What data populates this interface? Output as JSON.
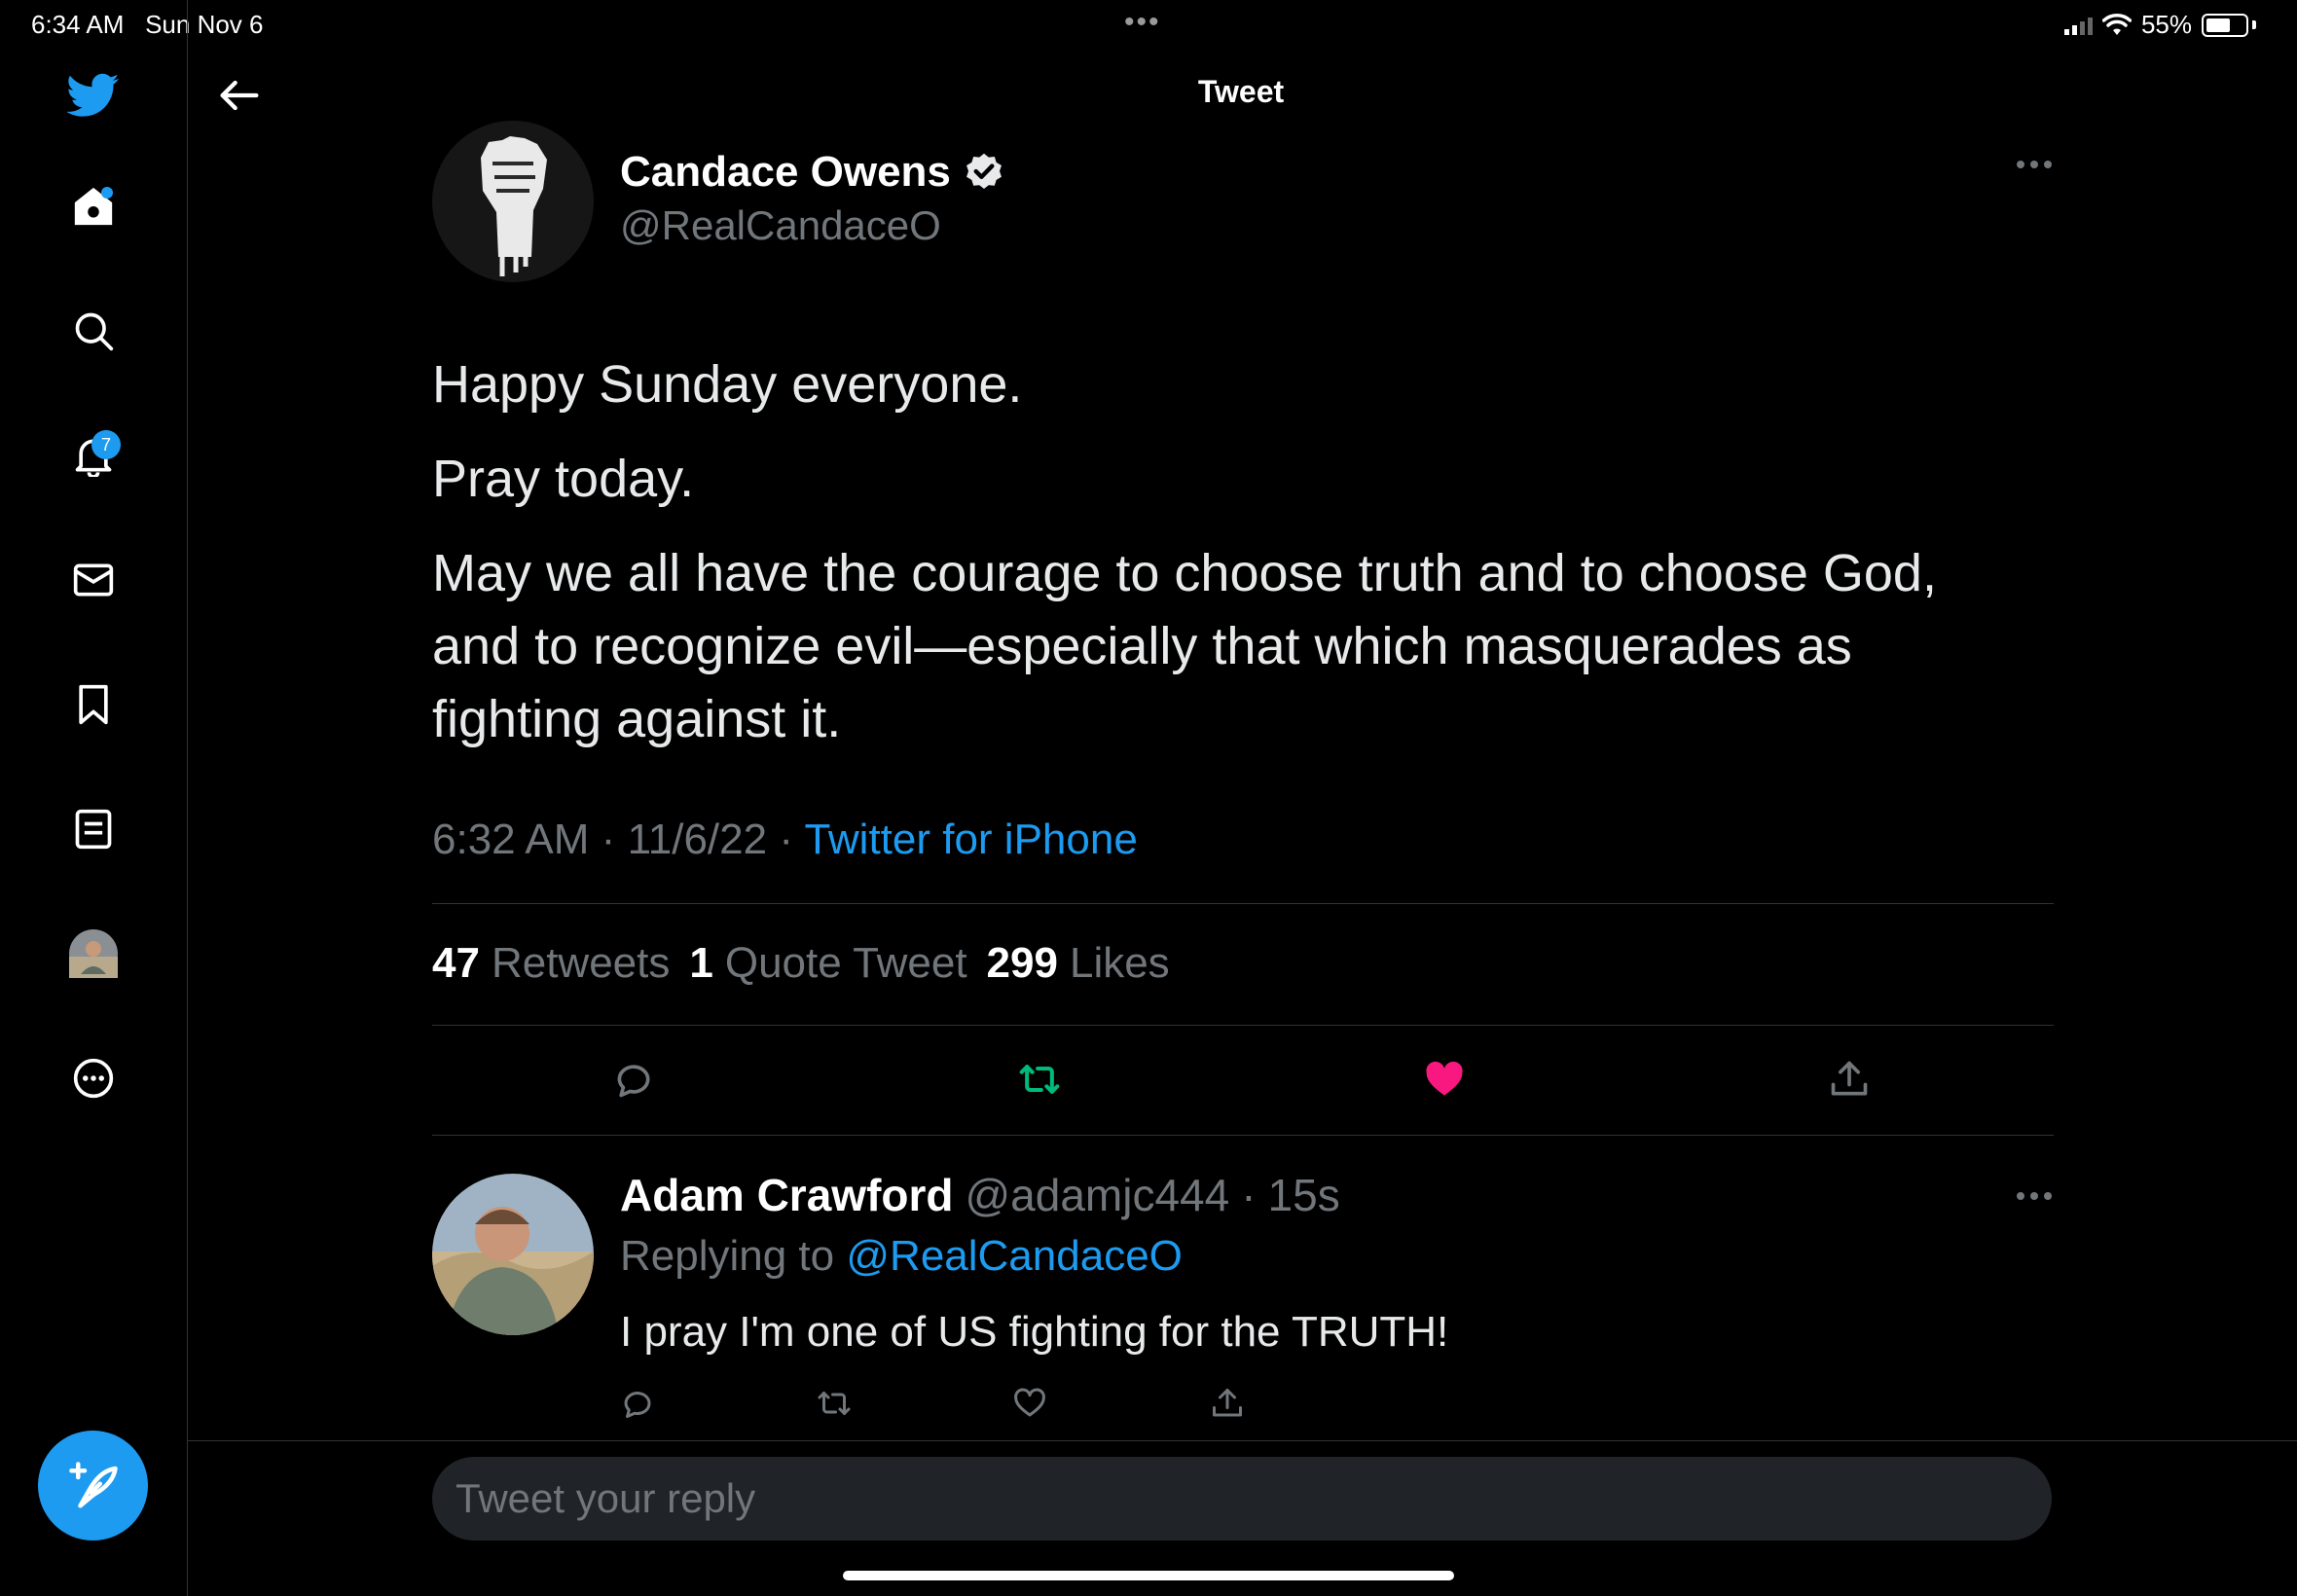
{
  "status_bar": {
    "time": "6:34 AM",
    "date": "Sun Nov 6",
    "battery": "55%",
    "dots": "•••"
  },
  "sidebar": {
    "items": [
      {
        "icon": "twitter-logo-icon"
      },
      {
        "icon": "home-icon",
        "has_dot": true
      },
      {
        "icon": "search-icon"
      },
      {
        "icon": "notifications-icon",
        "badge": "7"
      },
      {
        "icon": "messages-icon"
      },
      {
        "icon": "bookmarks-icon"
      },
      {
        "icon": "lists-icon"
      },
      {
        "icon": "profile-avatar"
      },
      {
        "icon": "more-icon"
      }
    ],
    "compose_icon": "compose-tweet-icon"
  },
  "header": {
    "title": "Tweet"
  },
  "tweet": {
    "author_name": "Candace Owens",
    "author_handle": "@RealCandaceO",
    "verified": true,
    "lines": [
      "Happy Sunday everyone.",
      "Pray today.",
      "May we all have the courage to choose truth and to choose God,",
      "and to recognize evil—especially that which masquerades as",
      "fighting against it."
    ],
    "time": "6:32 AM",
    "date": "11/6/22",
    "separator": "·",
    "source": "Twitter for iPhone",
    "stats": {
      "retweets_count": "47",
      "retweets_label": "Retweets",
      "quotes_count": "1",
      "quotes_label": "Quote Tweet",
      "likes_count": "299",
      "likes_label": "Likes"
    },
    "liked": true,
    "retweeted": true
  },
  "reply": {
    "author_name": "Adam Crawford",
    "author_handle": "@adamjc444",
    "separator": "·",
    "time_ago": "15s",
    "replying_prefix": "Replying to",
    "replying_to": "@RealCandaceO",
    "text": "I pray I'm one of US fighting for the TRUTH!"
  },
  "composer": {
    "placeholder": "Tweet your reply"
  },
  "colors": {
    "accent": "#1d9bf0",
    "like": "#f91880",
    "retweet": "#00ba7c",
    "muted": "#71767b"
  }
}
